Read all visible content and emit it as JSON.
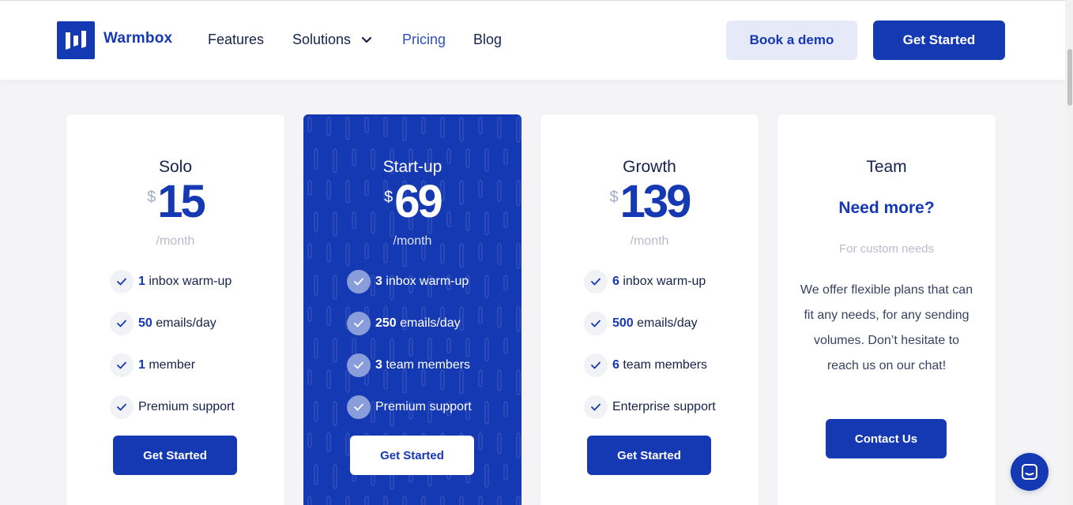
{
  "brand": {
    "name": "Warmbox"
  },
  "nav": {
    "items": [
      {
        "label": "Features"
      },
      {
        "label": "Solutions"
      },
      {
        "label": "Pricing"
      },
      {
        "label": "Blog"
      }
    ],
    "book_demo": "Book a demo",
    "get_started": "Get Started"
  },
  "plans": [
    {
      "name": "Solo",
      "currency": "$",
      "price": "15",
      "period": "/month",
      "features": [
        {
          "num": "1",
          "text": " inbox warm-up"
        },
        {
          "num": "50",
          "text": " emails/day"
        },
        {
          "num": "1",
          "text": " member"
        },
        {
          "num": "",
          "text": "Premium support"
        }
      ],
      "cta": "Get Started"
    },
    {
      "name": "Start-up",
      "currency": "$",
      "price": "69",
      "period": "/month",
      "features": [
        {
          "num": "3",
          "text": " inbox warm-up"
        },
        {
          "num": "250",
          "text": " emails/day"
        },
        {
          "num": "3",
          "text": " team members"
        },
        {
          "num": "",
          "text": "Premium support"
        }
      ],
      "cta": "Get Started"
    },
    {
      "name": "Growth",
      "currency": "$",
      "price": "139",
      "period": "/month",
      "features": [
        {
          "num": "6",
          "text": " inbox warm-up"
        },
        {
          "num": "500",
          "text": " emails/day"
        },
        {
          "num": "6",
          "text": " team members"
        },
        {
          "num": "",
          "text": "Enterprise support"
        }
      ],
      "cta": "Get Started"
    }
  ],
  "team": {
    "name": "Team",
    "headline": "Need more?",
    "subtitle": "For custom needs",
    "description": "We offer flexible plans that can fit any needs, for any sending volumes. Don’t hesitate to reach us on our chat!",
    "cta": "Contact Us"
  },
  "colors": {
    "brand": "#1538b3",
    "text": "#16224a",
    "muted": "#b8bccb"
  },
  "icons": {
    "chat": "chat-icon",
    "check": "check-icon",
    "chevron": "chevron-down-icon"
  }
}
